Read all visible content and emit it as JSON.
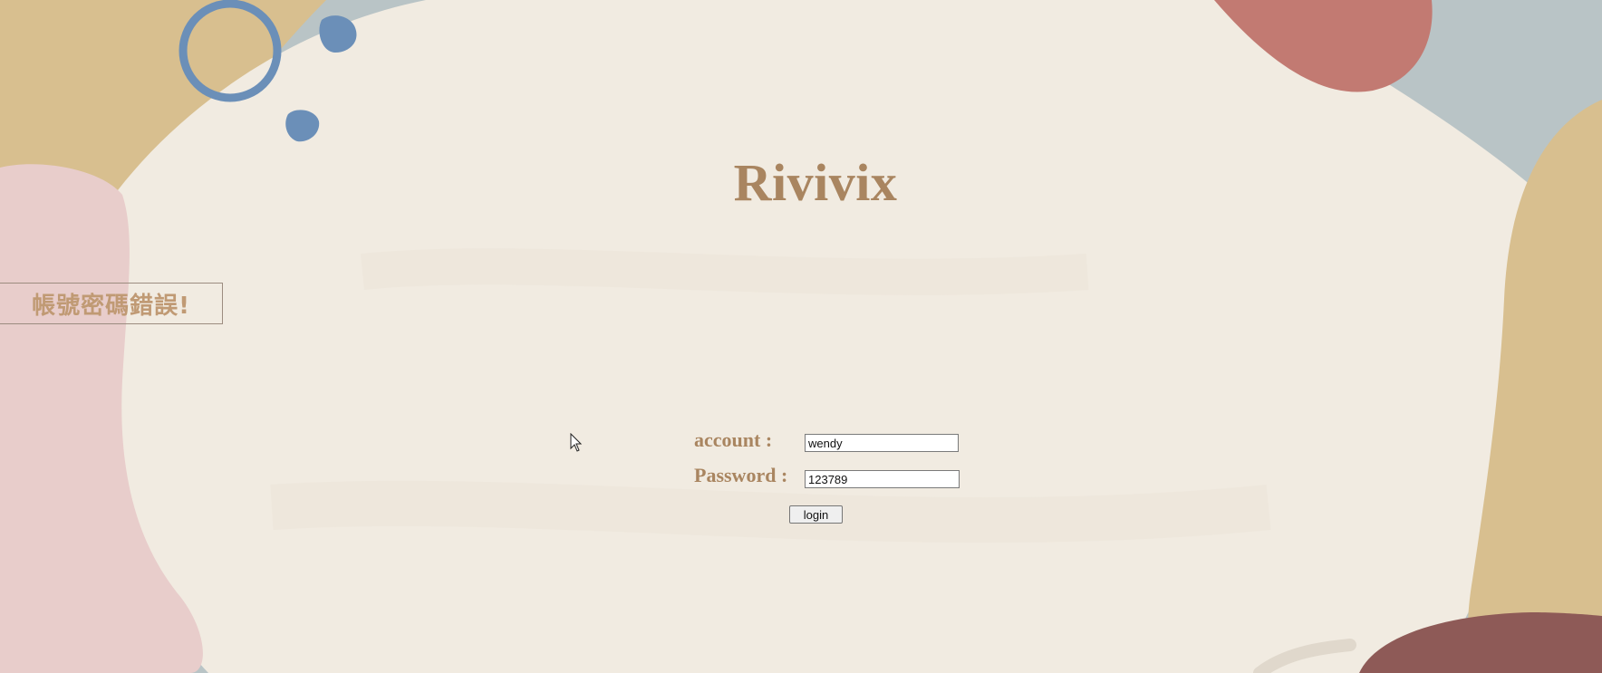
{
  "app": {
    "title": "Rivivix"
  },
  "error": {
    "message": "帳號密碼錯誤!"
  },
  "form": {
    "account_label": "account :",
    "account_value": "wendy",
    "password_label": "Password :",
    "password_value": "123789",
    "login_label": "login"
  },
  "colors": {
    "background_cream": "#f1ebe1",
    "title_brown": "#a98560",
    "error_text": "#c09a74",
    "blob_mustard": "#d8bf8f",
    "blob_pink": "#e8cdcb",
    "blob_red": "#c27a72",
    "blob_blue_gray": "#b9c4c6",
    "blob_maroon": "#8e5a57",
    "circle_blue": "#6b8fb8"
  },
  "icons": {
    "cursor": "mouse-pointer-icon"
  }
}
